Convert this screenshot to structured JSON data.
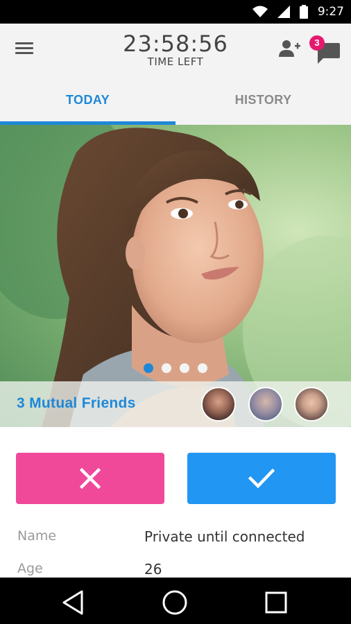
{
  "status_bar": {
    "time": "9:27",
    "icons": [
      "wifi-icon",
      "signal-icon",
      "battery-icon"
    ]
  },
  "header": {
    "timer": "23:58:56",
    "timer_label": "TIME LEFT",
    "icons": [
      "menu-icon",
      "add-user-icon",
      "chat-icon"
    ],
    "chat_badge": "3"
  },
  "tabs": [
    {
      "label": "TODAY",
      "active": true
    },
    {
      "label": "HISTORY",
      "active": false
    }
  ],
  "photo": {
    "slide_count": 4,
    "active_slide": 1
  },
  "mutual": {
    "text": "3 Mutual Friends",
    "avatar_count": 3
  },
  "actions": {
    "reject_icon": "close-icon",
    "accept_icon": "check-icon"
  },
  "profile": [
    {
      "label": "Name",
      "value": "Private until connected"
    },
    {
      "label": "Age",
      "value": "26"
    }
  ],
  "nav": {
    "icons": [
      "back-icon",
      "home-icon",
      "recents-icon"
    ]
  },
  "colors": {
    "accent": "#1e88d8",
    "reject": "#f0499a",
    "accept": "#2196f3",
    "badge": "#e6196f"
  }
}
